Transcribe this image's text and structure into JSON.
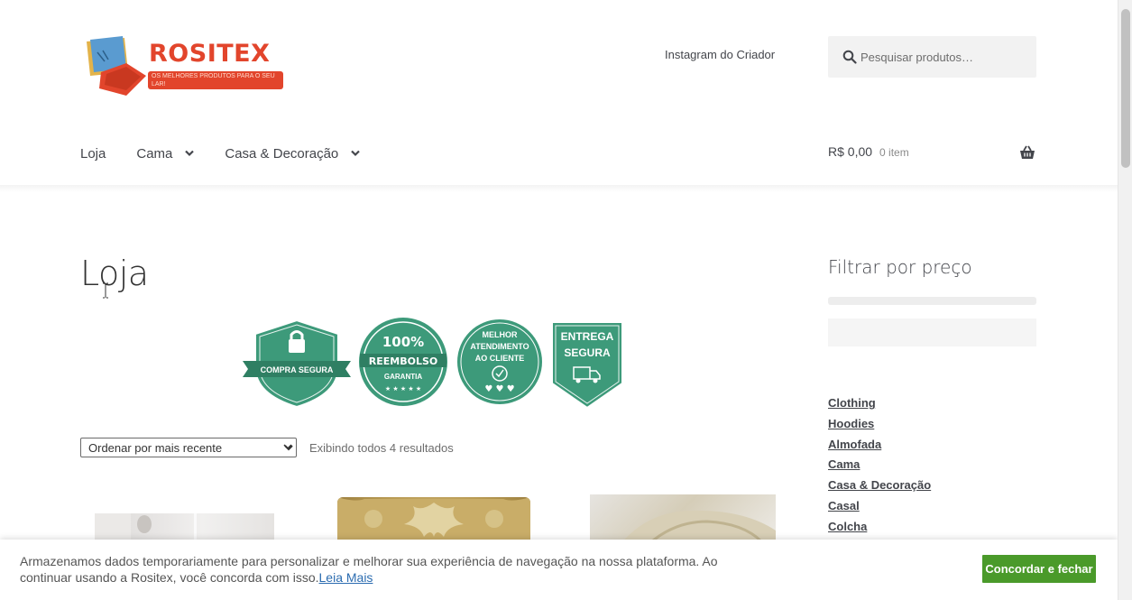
{
  "brand": {
    "name": "ROSITEX",
    "tagline": "OS MELHORES PRODUTOS PARA O SEU LAR!"
  },
  "header": {
    "top_link": "Instagram do Criador",
    "search_placeholder": "Pesquisar produtos…"
  },
  "nav": {
    "items": [
      {
        "label": "Loja",
        "has_dropdown": false
      },
      {
        "label": "Cama",
        "has_dropdown": true
      },
      {
        "label": "Casa & Decoração",
        "has_dropdown": true
      }
    ]
  },
  "cart": {
    "total": "R$ 0,00",
    "count": "0 item"
  },
  "main": {
    "title": "Loja",
    "badges": [
      {
        "label": "COMPRA SEGURA"
      },
      {
        "label_top": "100%",
        "label_mid": "REEMBOLSO",
        "label_bottom": "GARANTIA"
      },
      {
        "line1": "MELHOR",
        "line2": "ATENDIMENTO",
        "line3": "AO CLIENTE"
      },
      {
        "line1": "ENTREGA",
        "line2": "SEGURA"
      }
    ],
    "sort": {
      "selected": "Ordenar por mais recente",
      "options": [
        "Ordenar por mais recente"
      ]
    },
    "result_count": "Exibindo todos 4 resultados"
  },
  "sidebar": {
    "filter_title": "Filtrar por preço",
    "categories": [
      "Clothing",
      "Hoodies",
      "Almofada",
      "Cama",
      "Casa & Decoração",
      "Casal",
      "Colcha"
    ]
  },
  "cookie": {
    "text": "Armazenamos dados temporariamente para personalizar e melhorar sua experiência de navegação na nossa plataforma. Ao continuar usando a Rositex, você concorda com isso.",
    "link": "Leia Mais",
    "button": "Concordar e fechar"
  },
  "colors": {
    "brand": "#e2452c",
    "badge_green": "#3d9a7a",
    "accept_button": "#4a9a2a"
  }
}
